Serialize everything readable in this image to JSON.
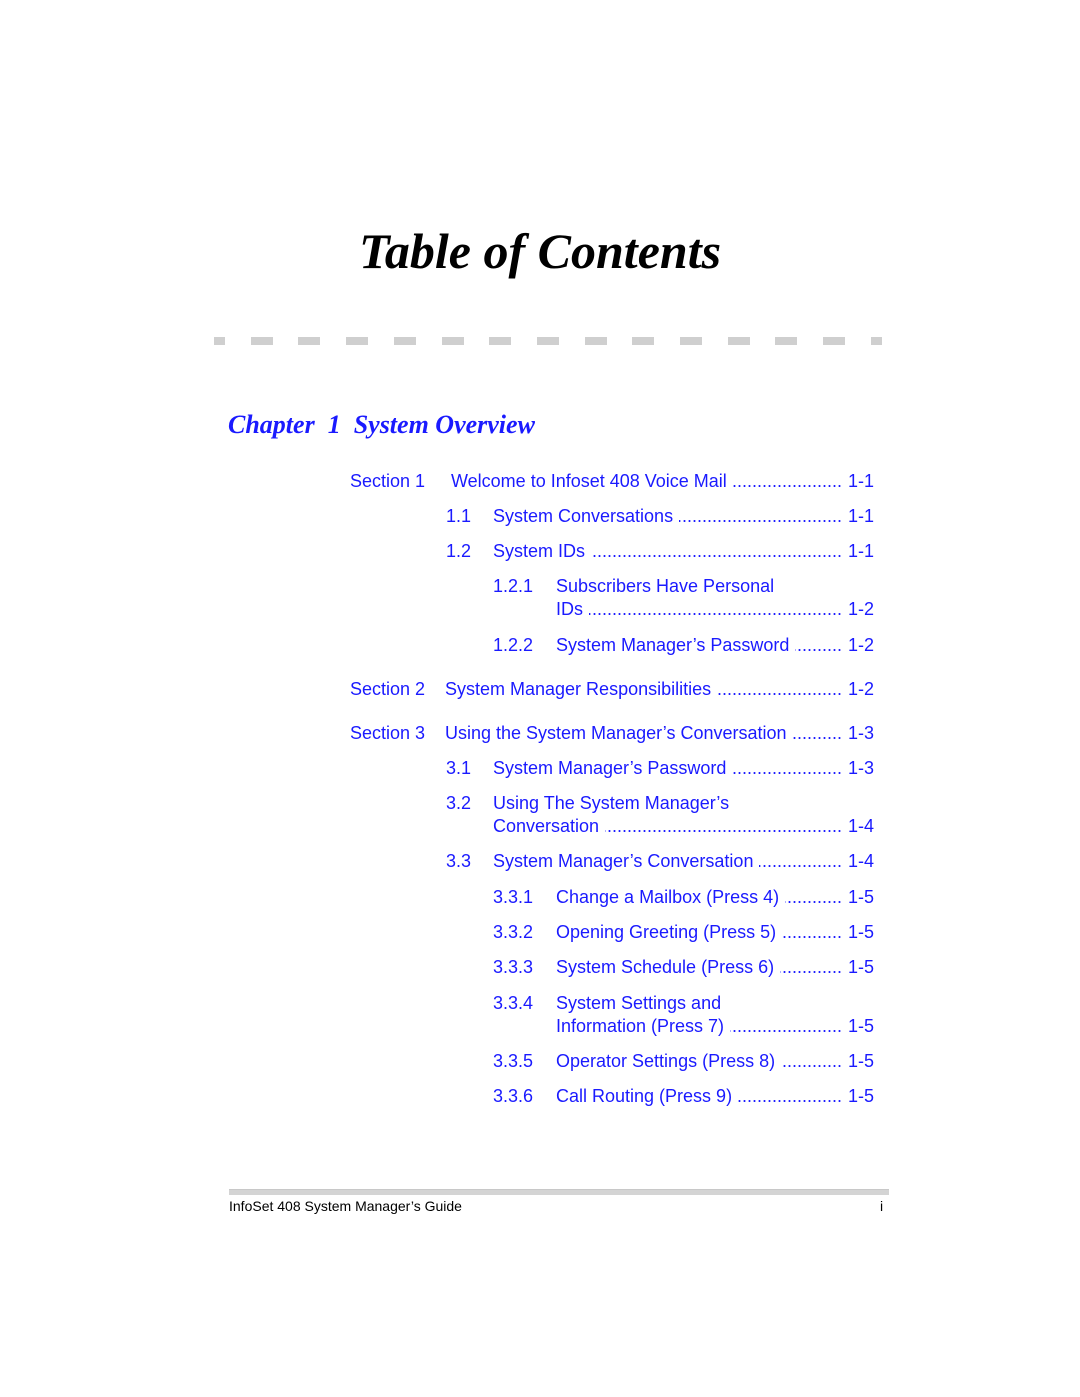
{
  "page": {
    "title": "Table of Contents",
    "chapter": {
      "label": "Chapter",
      "number": "1",
      "title": "System Overview"
    },
    "entries": [
      {
        "label": "Section  1",
        "text": "Welcome to Infoset 408 Voice Mail",
        "page": "1-1"
      },
      {
        "label": "1.1",
        "text": "System Conversations",
        "page": "1-1"
      },
      {
        "label": "1.2",
        "text": "System IDs",
        "page": "1-1"
      },
      {
        "label": "1.2.1",
        "text": "Subscribers Have Personal",
        "text2": "IDs",
        "page": "1-2"
      },
      {
        "label": "1.2.2",
        "text": "System Manager’s Password",
        "page": "1-2"
      },
      {
        "label": "Section 2",
        "text": "System Manager Responsibilities",
        "page": "1-2"
      },
      {
        "label": "Section 3",
        "text": "Using the System Manager’s Conversation",
        "page": "1-3"
      },
      {
        "label": "3.1",
        "text": "System Manager’s Password",
        "page": "1-3"
      },
      {
        "label": "3.2",
        "text": "Using The System Manager’s",
        "text2": "Conversation",
        "page": "1-4"
      },
      {
        "label": "3.3",
        "text": "System Manager’s Conversation",
        "page": "1-4"
      },
      {
        "label": "3.3.1",
        "text": "Change a Mailbox (Press 4)",
        "page": "1-5"
      },
      {
        "label": "3.3.2",
        "text": "Opening Greeting  (Press 5)",
        "page": "1-5"
      },
      {
        "label": "3.3.3",
        "text": "System Schedule (Press 6)",
        "page": "1-5"
      },
      {
        "label": "3.3.4",
        "text": "System Settings and",
        "text2": "Information (Press 7)",
        "page": "1-5"
      },
      {
        "label": "3.3.5",
        "text": "Operator Settings (Press 8)",
        "page": "1-5"
      },
      {
        "label": "3.3.6",
        "text": "Call Routing (Press 9)",
        "page": "1-5"
      }
    ],
    "footer": {
      "title": "InfoSet 408 System Manager’s Guide",
      "page_number": "i"
    },
    "link_color": "#1a1aff"
  }
}
